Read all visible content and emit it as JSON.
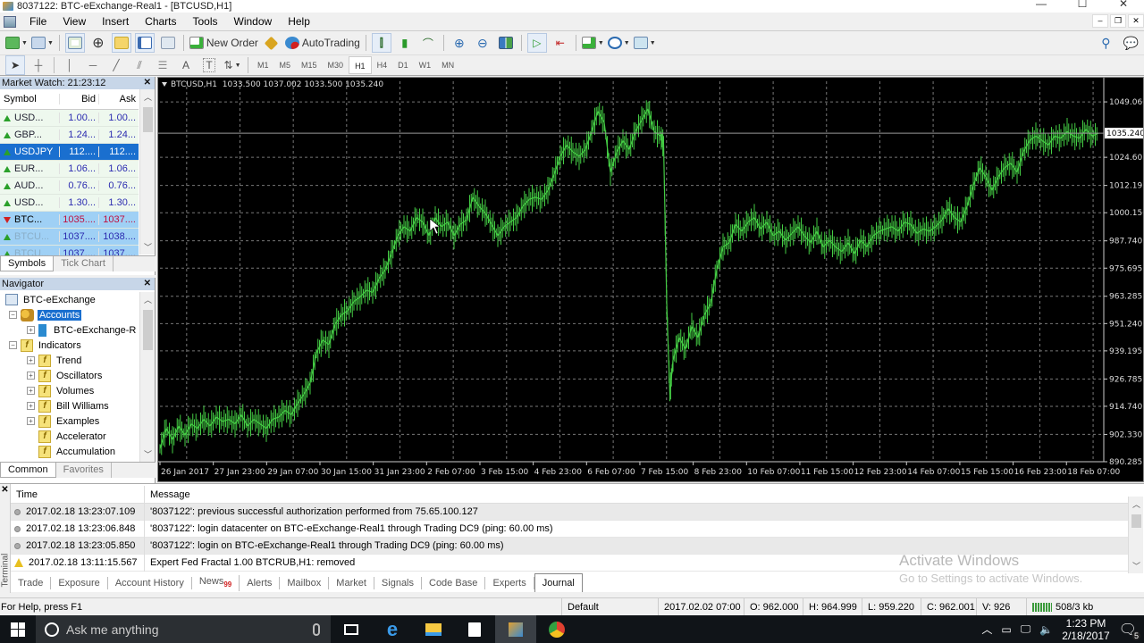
{
  "window": {
    "title": "8037122: BTC-eExchange-Real1 - [BTCUSD,H1]",
    "controls": [
      "—",
      "☐",
      "✕"
    ]
  },
  "menu": [
    "File",
    "View",
    "Insert",
    "Charts",
    "Tools",
    "Window",
    "Help"
  ],
  "toolbar": {
    "new_order": "New Order",
    "auto_trading": "AutoTrading",
    "timeframes": [
      "M1",
      "M5",
      "M15",
      "M30",
      "H1",
      "H4",
      "D1",
      "W1",
      "MN"
    ],
    "active_timeframe": "H1"
  },
  "market_watch": {
    "title": "Market Watch: 21:23:12",
    "columns": [
      "Symbol",
      "Bid",
      "Ask"
    ],
    "rows": [
      {
        "symbol": "USD...",
        "bid": "1.00...",
        "ask": "1.00...",
        "dir": "up",
        "state": "normal"
      },
      {
        "symbol": "GBP...",
        "bid": "1.24...",
        "ask": "1.24...",
        "dir": "up",
        "state": "normal"
      },
      {
        "symbol": "USDJPY",
        "bid": "112....",
        "ask": "112....",
        "dir": "up",
        "state": "selected"
      },
      {
        "symbol": "EUR...",
        "bid": "1.06...",
        "ask": "1.06...",
        "dir": "up",
        "state": "normal"
      },
      {
        "symbol": "AUD...",
        "bid": "0.76...",
        "ask": "0.76...",
        "dir": "up",
        "state": "normal"
      },
      {
        "symbol": "USD...",
        "bid": "1.30...",
        "ask": "1.30...",
        "dir": "up",
        "state": "normal"
      },
      {
        "symbol": "BTC...",
        "bid": "1035....",
        "ask": "1037....",
        "dir": "down",
        "state": "highlight"
      },
      {
        "symbol": "BTCU...",
        "bid": "1037....",
        "ask": "1038....",
        "dir": "up",
        "state": "highlight-faded"
      },
      {
        "symbol": "BTCU...",
        "bid": "1037....",
        "ask": "1037....",
        "dir": "up",
        "state": "highlight-faded"
      }
    ],
    "tabs": [
      "Symbols",
      "Tick Chart"
    ],
    "active_tab": "Symbols"
  },
  "navigator": {
    "title": "Navigator",
    "tree": [
      {
        "label": "BTC-eExchange",
        "level": 0,
        "icon": "terminal-icon",
        "expander": ""
      },
      {
        "label": "Accounts",
        "level": 1,
        "icon": "accounts-icon",
        "expander": "−",
        "selected": true
      },
      {
        "label": "BTC-eExchange-R",
        "level": 2,
        "icon": "server-icon",
        "expander": "+"
      },
      {
        "label": "Indicators",
        "level": 1,
        "icon": "indicator-folder-icon",
        "expander": "−"
      },
      {
        "label": "Trend",
        "level": 2,
        "icon": "indicator-folder-icon",
        "expander": "+"
      },
      {
        "label": "Oscillators",
        "level": 2,
        "icon": "indicator-folder-icon",
        "expander": "+"
      },
      {
        "label": "Volumes",
        "level": 2,
        "icon": "indicator-folder-icon",
        "expander": "+"
      },
      {
        "label": "Bill Williams",
        "level": 2,
        "icon": "indicator-folder-icon",
        "expander": "+"
      },
      {
        "label": "Examples",
        "level": 2,
        "icon": "indicator-custom-icon",
        "expander": "+"
      },
      {
        "label": "Accelerator",
        "level": 2,
        "icon": "indicator-custom-icon",
        "expander": ""
      },
      {
        "label": "Accumulation",
        "level": 2,
        "icon": "indicator-custom-icon",
        "expander": ""
      }
    ],
    "tabs": [
      "Common",
      "Favorites"
    ],
    "active_tab": "Common"
  },
  "chart_data": {
    "type": "bar",
    "title": "BTCUSD,H1",
    "ohlc_label": "1033.500 1037.002 1033.500 1035.240",
    "current_price": "1035.240",
    "series_color": "#44cc44",
    "background": "#000000",
    "grid": true,
    "ylim": [
      890.285,
      1055.0
    ],
    "y_ticks": [
      "1049.060",
      "1024.605",
      "1012.195",
      "1000.150",
      "987.740",
      "975.695",
      "963.285",
      "951.240",
      "939.195",
      "926.785",
      "914.740",
      "902.330",
      "890.285"
    ],
    "x_ticks": [
      "26 Jan 2017",
      "27 Jan 23:00",
      "29 Jan 07:00",
      "30 Jan 15:00",
      "31 Jan 23:00",
      "2 Feb 07:00",
      "3 Feb 15:00",
      "4 Feb 23:00",
      "6 Feb 07:00",
      "7 Feb 15:00",
      "8 Feb 23:00",
      "10 Feb 07:00",
      "11 Feb 15:00",
      "12 Feb 23:00",
      "14 Feb 07:00",
      "15 Feb 15:00",
      "16 Feb 23:00",
      "18 Feb 07:00"
    ],
    "path_points": [
      [
        0,
        896
      ],
      [
        4,
        905
      ],
      [
        8,
        900
      ],
      [
        12,
        906
      ],
      [
        16,
        902
      ],
      [
        20,
        907
      ],
      [
        24,
        905
      ],
      [
        28,
        909
      ],
      [
        32,
        906
      ],
      [
        36,
        910
      ],
      [
        40,
        908
      ],
      [
        44,
        909
      ],
      [
        48,
        907
      ],
      [
        52,
        911
      ],
      [
        56,
        906
      ],
      [
        60,
        909
      ],
      [
        64,
        907
      ],
      [
        68,
        905
      ],
      [
        72,
        909
      ],
      [
        76,
        910
      ],
      [
        80,
        913
      ],
      [
        84,
        911
      ],
      [
        88,
        916
      ],
      [
        92,
        920
      ],
      [
        96,
        925
      ],
      [
        100,
        938
      ],
      [
        104,
        944
      ],
      [
        108,
        942
      ],
      [
        112,
        951
      ],
      [
        116,
        955
      ],
      [
        120,
        957
      ],
      [
        124,
        961
      ],
      [
        128,
        963
      ],
      [
        132,
        966
      ],
      [
        136,
        965
      ],
      [
        140,
        971
      ],
      [
        144,
        975
      ],
      [
        148,
        982
      ],
      [
        152,
        990
      ],
      [
        156,
        994
      ],
      [
        160,
        992
      ],
      [
        164,
        998
      ],
      [
        168,
        996
      ],
      [
        172,
        990
      ],
      [
        176,
        998
      ],
      [
        180,
        994
      ],
      [
        184,
        996
      ],
      [
        188,
        990
      ],
      [
        192,
        995
      ],
      [
        196,
        997
      ],
      [
        200,
        1007
      ],
      [
        204,
        1003
      ],
      [
        208,
        1000
      ],
      [
        212,
        995
      ],
      [
        216,
        990
      ],
      [
        220,
        994
      ],
      [
        224,
        996
      ],
      [
        228,
        998
      ],
      [
        232,
        1003
      ],
      [
        236,
        1006
      ],
      [
        240,
        1007
      ],
      [
        244,
        1006
      ],
      [
        248,
        1010
      ],
      [
        252,
        1017
      ],
      [
        256,
        1025
      ],
      [
        260,
        1030
      ],
      [
        264,
        1027
      ],
      [
        268,
        1025
      ],
      [
        272,
        1028
      ],
      [
        276,
        1036
      ],
      [
        280,
        1045
      ],
      [
        284,
        1040
      ],
      [
        288,
        1018
      ],
      [
        292,
        1027
      ],
      [
        296,
        1032
      ],
      [
        300,
        1028
      ],
      [
        304,
        1036
      ],
      [
        308,
        1041
      ],
      [
        312,
        1046
      ],
      [
        316,
        1036
      ],
      [
        320,
        1034
      ],
      [
        322,
        1030
      ],
      [
        324,
        960
      ],
      [
        326,
        920
      ],
      [
        328,
        935
      ],
      [
        332,
        945
      ],
      [
        336,
        940
      ],
      [
        340,
        950
      ],
      [
        344,
        945
      ],
      [
        348,
        955
      ],
      [
        352,
        960
      ],
      [
        356,
        975
      ],
      [
        360,
        985
      ],
      [
        364,
        987
      ],
      [
        368,
        995
      ],
      [
        372,
        992
      ],
      [
        376,
        996
      ],
      [
        380,
        998
      ],
      [
        384,
        993
      ],
      [
        388,
        996
      ],
      [
        392,
        990
      ],
      [
        396,
        992
      ],
      [
        400,
        988
      ],
      [
        404,
        991
      ],
      [
        408,
        994
      ],
      [
        412,
        990
      ],
      [
        416,
        987
      ],
      [
        420,
        992
      ],
      [
        424,
        985
      ],
      [
        428,
        988
      ],
      [
        432,
        985
      ],
      [
        436,
        983
      ],
      [
        440,
        987
      ],
      [
        444,
        982
      ],
      [
        448,
        988
      ],
      [
        452,
        985
      ],
      [
        456,
        990
      ],
      [
        460,
        992
      ],
      [
        464,
        993
      ],
      [
        468,
        994
      ],
      [
        472,
        992
      ],
      [
        476,
        996
      ],
      [
        480,
        995
      ],
      [
        484,
        991
      ],
      [
        488,
        993
      ],
      [
        492,
        992
      ],
      [
        496,
        994
      ],
      [
        500,
        997
      ],
      [
        504,
        1002
      ],
      [
        508,
        998
      ],
      [
        512,
        996
      ],
      [
        516,
        1003
      ],
      [
        520,
        1012
      ],
      [
        524,
        1020
      ],
      [
        528,
        1016
      ],
      [
        532,
        1010
      ],
      [
        536,
        1016
      ],
      [
        540,
        1020
      ],
      [
        544,
        1022
      ],
      [
        548,
        1018
      ],
      [
        552,
        1027
      ],
      [
        556,
        1032
      ],
      [
        560,
        1034
      ],
      [
        564,
        1032
      ],
      [
        568,
        1030
      ],
      [
        572,
        1034
      ],
      [
        576,
        1033
      ],
      [
        580,
        1036
      ],
      [
        584,
        1034
      ],
      [
        588,
        1033
      ],
      [
        592,
        1037
      ],
      [
        596,
        1034
      ],
      [
        600,
        1035.24
      ]
    ]
  },
  "terminal": {
    "side_label": "Terminal",
    "columns": [
      "Time",
      "Message"
    ],
    "rows": [
      {
        "type": "info",
        "time": "2017.02.18 13:23:07.109",
        "message": "'8037122': previous successful authorization performed from 75.65.100.127"
      },
      {
        "type": "info",
        "time": "2017.02.18 13:23:06.848",
        "message": "'8037122': login datacenter on BTC-eExchange-Real1 through Trading DC9 (ping: 60.00 ms)"
      },
      {
        "type": "info",
        "time": "2017.02.18 13:23:05.850",
        "message": "'8037122': login on BTC-eExchange-Real1 through Trading DC9 (ping: 60.00 ms)"
      },
      {
        "type": "warning",
        "time": "2017.02.18 13:11:15.567",
        "message": "Expert Fed Fractal 1.00 BTCRUB,H1: removed"
      }
    ],
    "tabs": [
      "Trade",
      "Exposure",
      "Account History",
      "News",
      "Alerts",
      "Mailbox",
      "Market",
      "Signals",
      "Code Base",
      "Experts",
      "Journal"
    ],
    "news_badge": "99",
    "active_tab": "Journal"
  },
  "watermark": {
    "line1": "Activate Windows",
    "line2": "Go to Settings to activate Windows."
  },
  "status": {
    "help": "For Help, press F1",
    "profile": "Default",
    "datetime": "2017.02.02 07:00",
    "open": "O: 962.000",
    "high": "H: 964.999",
    "low": "L: 959.220",
    "close": "C: 962.001",
    "volume": "V: 926",
    "traffic": "508/3 kb"
  },
  "taskbar": {
    "search_placeholder": "Ask me anything",
    "time": "1:23 PM",
    "date": "2/18/2017",
    "notifications": "5"
  }
}
